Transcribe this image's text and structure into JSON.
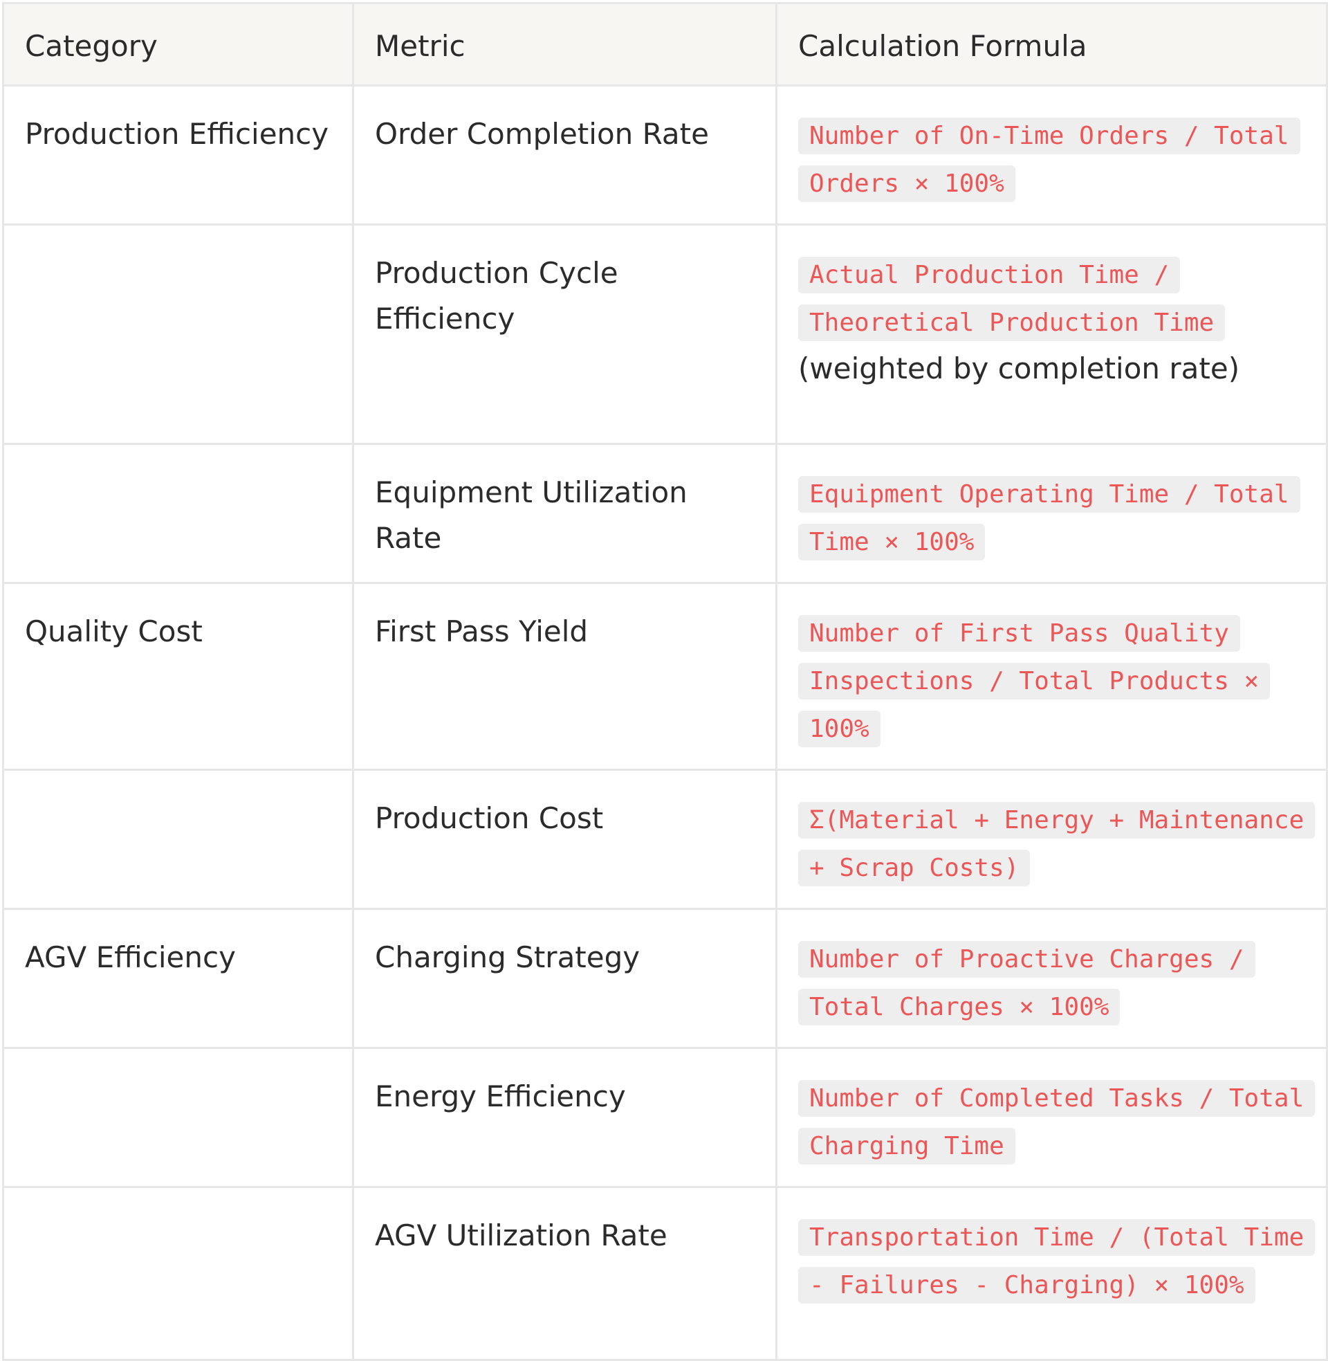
{
  "headers": {
    "category": "Category",
    "metric": "Metric",
    "formula": "Calculation Formula"
  },
  "rows": [
    {
      "category": "Production Efficiency",
      "metric": "Order Completion Rate",
      "formula_code": "Number of On-Time Orders / Total Orders × 100%",
      "formula_text": ""
    },
    {
      "category": "",
      "metric": "Production Cycle Efficiency",
      "formula_code": "Actual Production Time / Theoretical Production Time",
      "formula_text": "(weighted by completion rate)"
    },
    {
      "category": "",
      "metric": "Equipment Utilization Rate",
      "formula_code": "Equipment Operating Time / Total Time × 100%",
      "formula_text": ""
    },
    {
      "category": "Quality Cost",
      "metric": "First Pass Yield",
      "formula_code": "Number of First Pass Quality Inspections / Total Products × 100%",
      "formula_text": ""
    },
    {
      "category": "",
      "metric": "Production Cost",
      "formula_code": "Σ(Material + Energy + Maintenance + Scrap Costs)",
      "formula_text": ""
    },
    {
      "category": "AGV Efficiency",
      "metric": "Charging Strategy",
      "formula_code": "Number of Proactive Charges / Total Charges × 100%",
      "formula_text": ""
    },
    {
      "category": "",
      "metric": "Energy Efficiency",
      "formula_code": "Number of Completed Tasks / Total Charging Time",
      "formula_text": ""
    },
    {
      "category": "",
      "metric": "AGV Utilization Rate",
      "formula_code": "Transportation Time / (Total Time - Failures - Charging) × 100%",
      "formula_text": ""
    }
  ]
}
